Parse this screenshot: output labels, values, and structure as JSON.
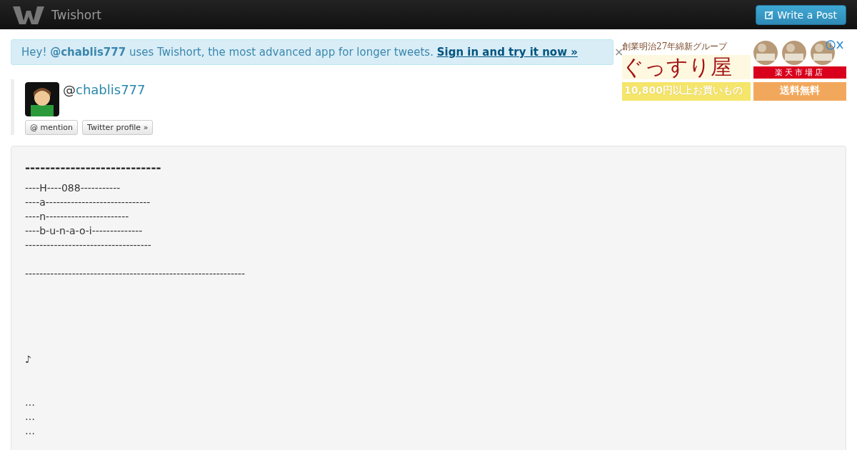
{
  "navbar": {
    "brand": "Twishort",
    "write_button": "Write a Post"
  },
  "alert": {
    "greeting": "Hey! ",
    "user": "@chablis777",
    "message": " uses Twishort, the most advanced app for longer tweets. ",
    "link": "Sign in and try it now »"
  },
  "ad": {
    "tagline": "創業明治27年綿新グループ",
    "shop": "ぐっすり屋",
    "store": "楽天市場店",
    "promo": "10,800円以上お買いもの",
    "shipping": "送料無料",
    "close": "×"
  },
  "profile": {
    "at": "@",
    "handle": "chablis777",
    "buttons": [
      "@ mention",
      "Twitter profile »"
    ]
  },
  "post": {
    "heading": "---------------------------",
    "blocks": [
      [
        "----H----088-----------",
        "----a-----------------------------",
        "----n-----------------------",
        "----b-u-n-a-o-i--------------",
        "-----------------------------------"
      ],
      [
        "-------------------------------------------------------------"
      ],
      [
        "♪"
      ],
      [
        "…",
        "…",
        "…"
      ]
    ]
  }
}
